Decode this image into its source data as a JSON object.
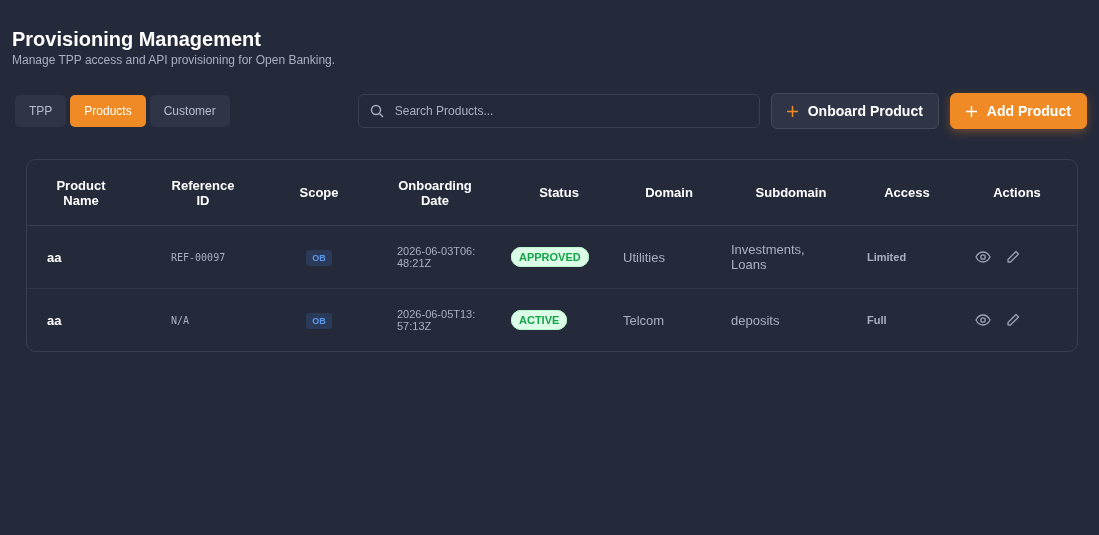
{
  "header": {
    "title": "Provisioning Management",
    "subtitle": "Manage TPP access and API provisioning for Open Banking."
  },
  "tabs": [
    {
      "label": "TPP",
      "selected": false
    },
    {
      "label": "Products",
      "selected": true
    },
    {
      "label": "Customer",
      "selected": false
    }
  ],
  "search": {
    "placeholder": "Search Products..."
  },
  "buttons": [
    {
      "label": "Onboard Product",
      "kind": "secondary"
    },
    {
      "label": "Add Product",
      "kind": "primary"
    }
  ],
  "table": {
    "columns": [
      "Product Name",
      "Reference ID",
      "Scope",
      "Onboarding Date",
      "Status",
      "Domain",
      "Subdomain",
      "Access",
      "Actions"
    ],
    "rows": [
      {
        "product_name": "aa",
        "reference_id": "REF-00097",
        "scope": "OB",
        "onboarding_date": "2026-06-03T06:48:21Z",
        "status": "APPROVED",
        "domain": "Utilities",
        "subdomain": "Investments, Loans",
        "access": "Limited"
      },
      {
        "product_name": "aa",
        "reference_id": "N/A",
        "scope": "OB",
        "onboarding_date": "2026-06-05T13:57:13Z",
        "status": "ACTIVE",
        "domain": "Telcom",
        "subdomain": "deposits",
        "access": "Full"
      }
    ]
  }
}
